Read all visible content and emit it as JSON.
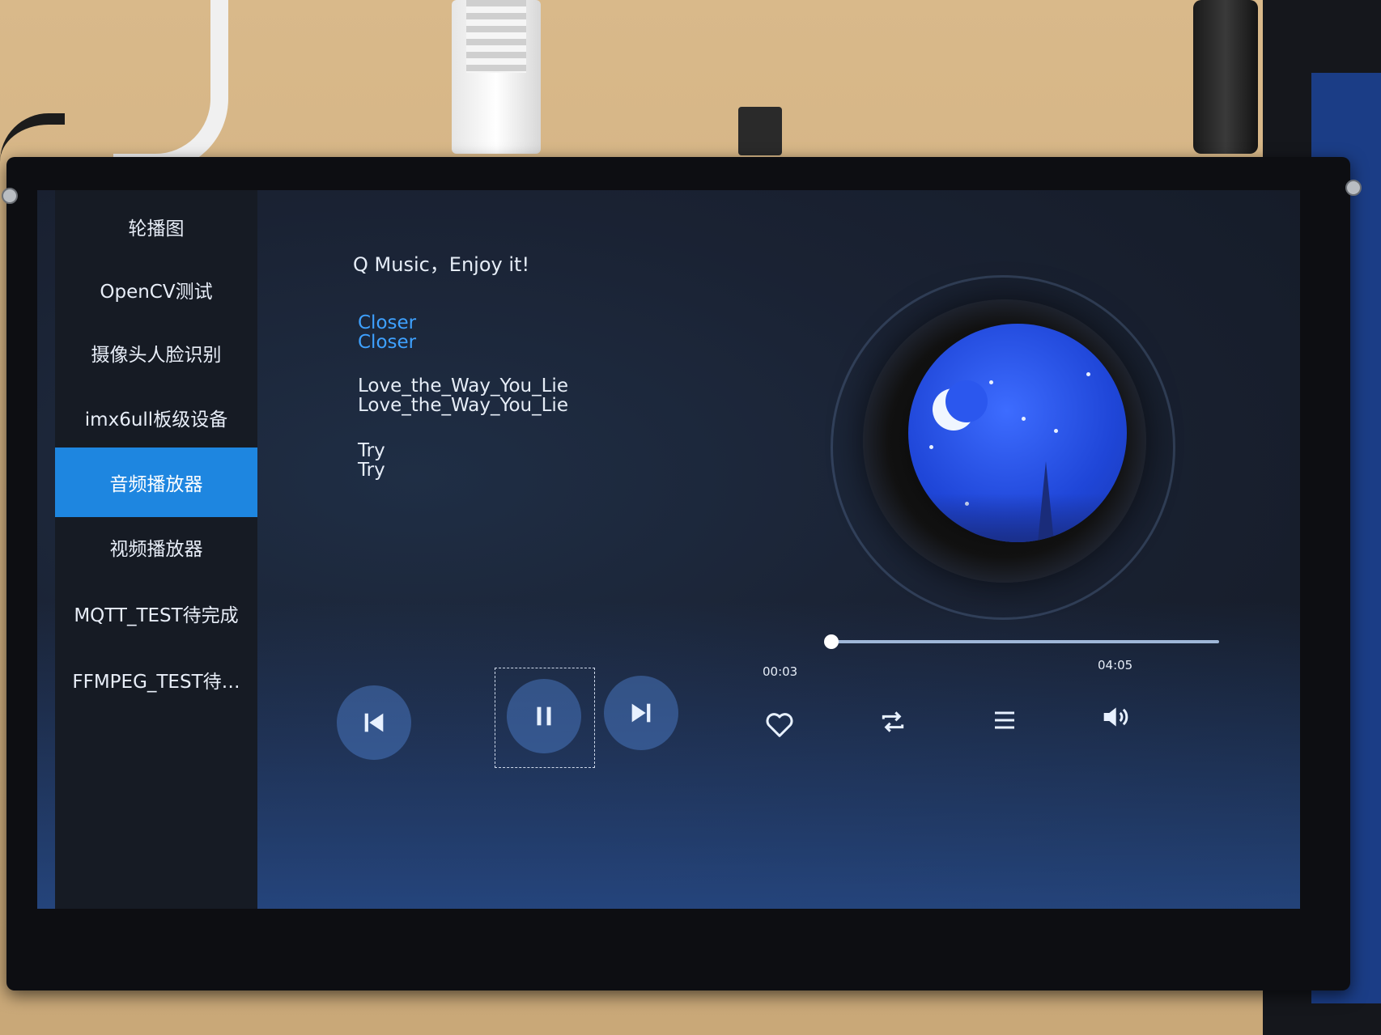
{
  "sidebar": {
    "items": [
      {
        "label": "轮播图"
      },
      {
        "label": "OpenCV测试"
      },
      {
        "label": "摄像头人脸识别"
      },
      {
        "label": "imx6ull板级设备"
      },
      {
        "label": "音频播放器",
        "active": true
      },
      {
        "label": "视频播放器"
      },
      {
        "label": "MQTT_TEST待完成"
      },
      {
        "label": "FFMPEG_TEST待…"
      }
    ]
  },
  "header": {
    "title": "Q Music，Enjoy it!"
  },
  "playlist": [
    {
      "title": "Closer",
      "artist": "Closer",
      "active": true
    },
    {
      "title": "Love_the_Way_You_Lie",
      "artist": "Love_the_Way_You_Lie"
    },
    {
      "title": "Try",
      "artist": "Try"
    }
  ],
  "player": {
    "elapsed": "00:03",
    "duration": "04:05",
    "progress_fraction": 0.012,
    "state": "playing"
  },
  "controls": {
    "prev_icon": "skip-previous-icon",
    "pause_icon": "pause-icon",
    "next_icon": "skip-next-icon",
    "favorite_icon": "heart-icon",
    "repeat_icon": "repeat-icon",
    "playlist_icon": "list-icon",
    "volume_icon": "volume-icon"
  },
  "colors": {
    "accent": "#1e86e0",
    "active_song": "#3ea1ff",
    "sidebar_bg": "#161b24"
  }
}
